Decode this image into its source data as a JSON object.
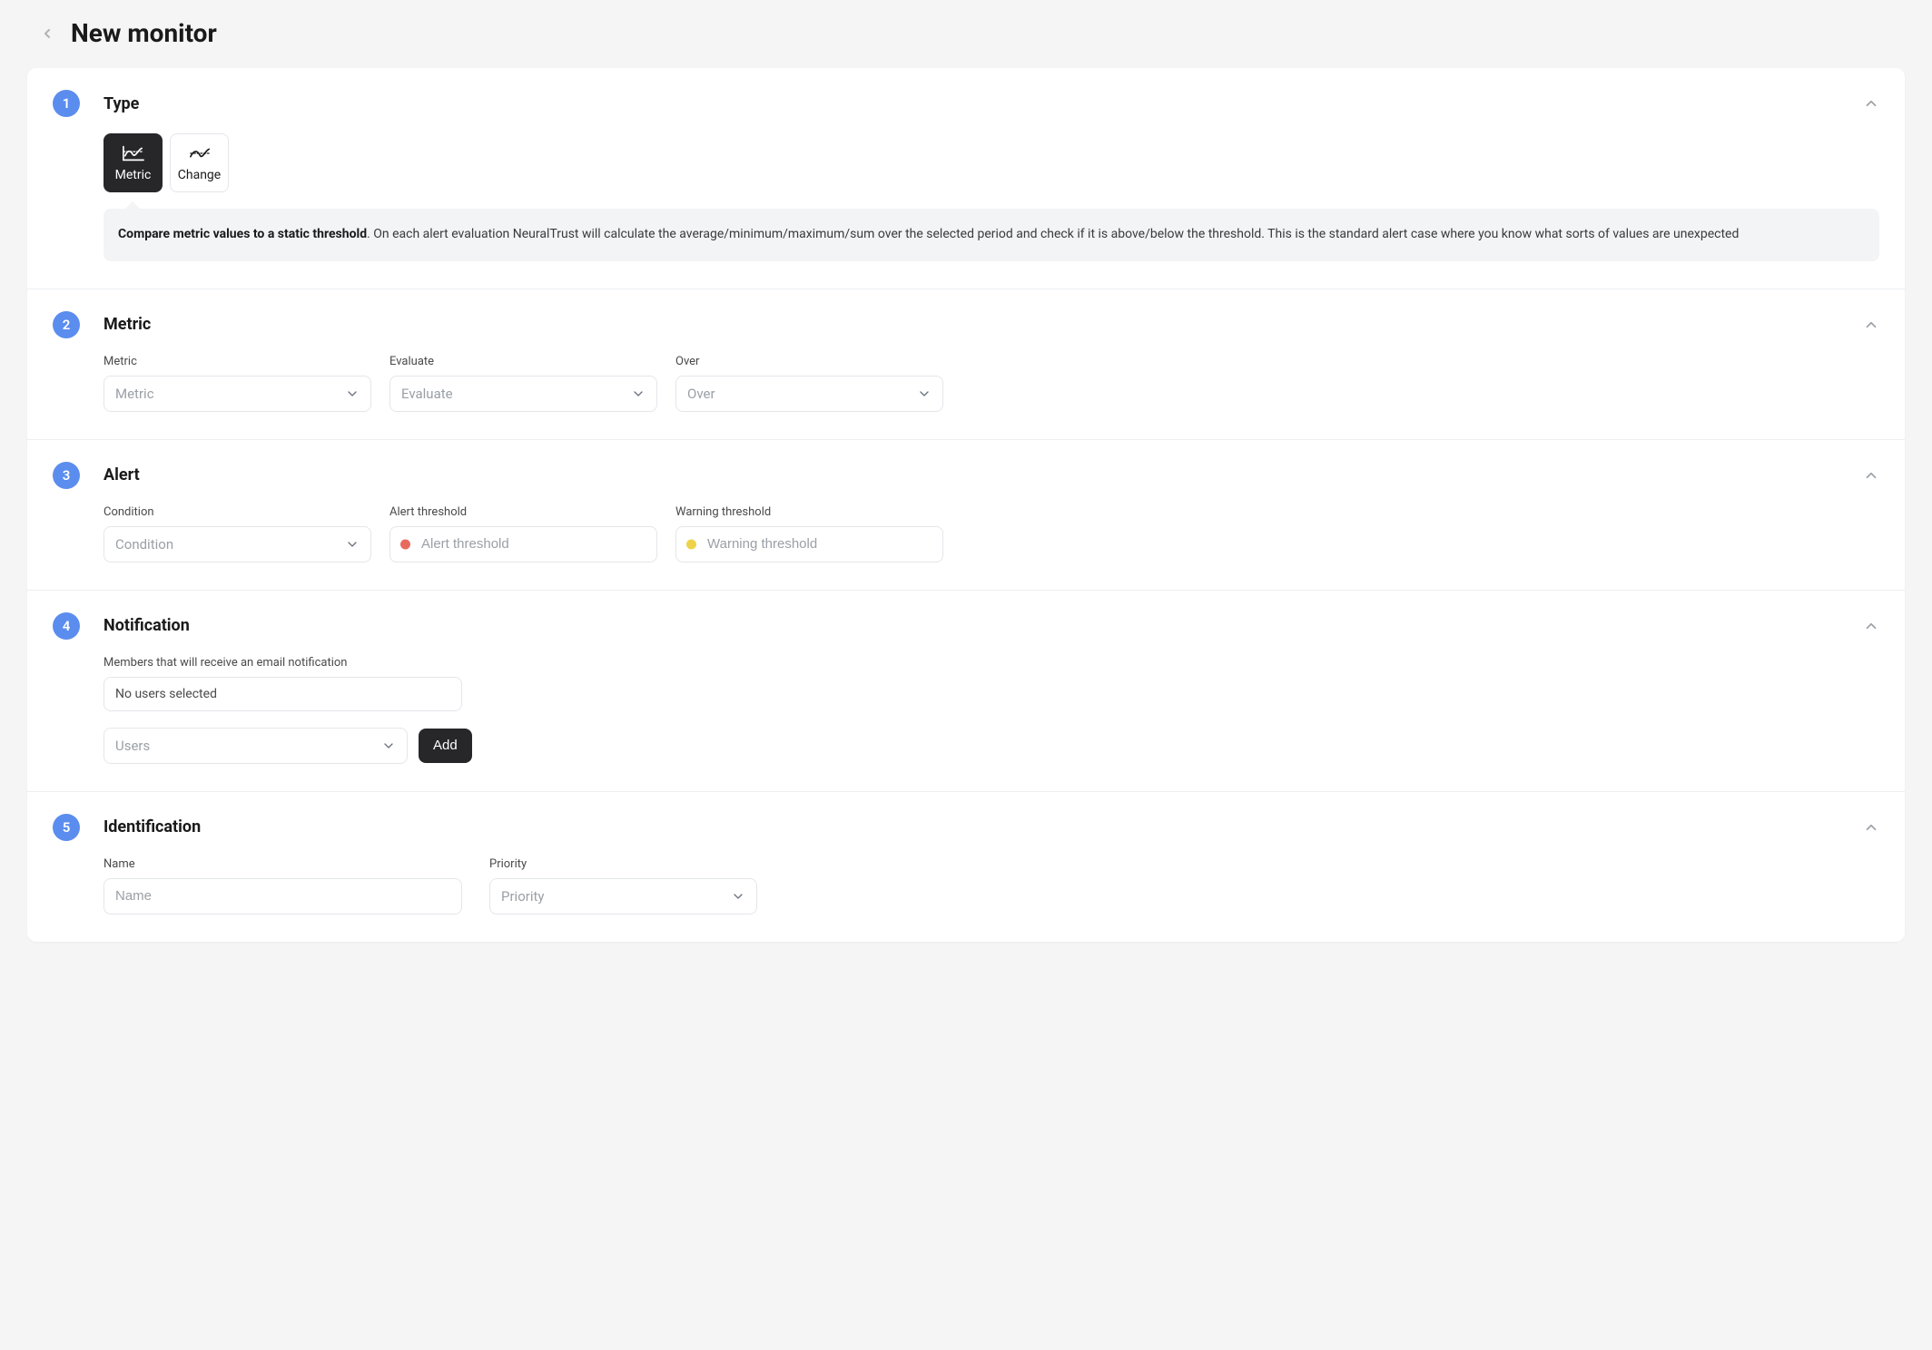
{
  "header": {
    "title": "New monitor"
  },
  "sections": {
    "type": {
      "step": "1",
      "title": "Type",
      "options": {
        "metric": "Metric",
        "change": "Change"
      },
      "info_lead": "Compare metric values to a static threshold",
      "info_body": ". On each alert evaluation NeuralTrust will calculate the average/minimum/maximum/sum over the selected period and check if it is above/below the threshold. This is the standard alert case where you know what sorts of values are unexpected"
    },
    "metric": {
      "step": "2",
      "title": "Metric",
      "fields": {
        "metric": {
          "label": "Metric",
          "placeholder": "Metric"
        },
        "evaluate": {
          "label": "Evaluate",
          "placeholder": "Evaluate"
        },
        "over": {
          "label": "Over",
          "placeholder": "Over"
        }
      }
    },
    "alert": {
      "step": "3",
      "title": "Alert",
      "fields": {
        "condition": {
          "label": "Condition",
          "placeholder": "Condition"
        },
        "alert_threshold": {
          "label": "Alert threshold",
          "placeholder": "Alert threshold"
        },
        "warning_threshold": {
          "label": "Warning threshold",
          "placeholder": "Warning threshold"
        }
      }
    },
    "notification": {
      "step": "4",
      "title": "Notification",
      "members_label": "Members that will receive an email notification",
      "empty_text": "No users selected",
      "users_placeholder": "Users",
      "add_label": "Add"
    },
    "identification": {
      "step": "5",
      "title": "Identification",
      "fields": {
        "name": {
          "label": "Name",
          "placeholder": "Name"
        },
        "priority": {
          "label": "Priority",
          "placeholder": "Priority"
        }
      }
    }
  },
  "colors": {
    "accent": "#5b8def",
    "dark": "#27272a",
    "red": "#e86a5e",
    "yellow": "#eed34a"
  }
}
